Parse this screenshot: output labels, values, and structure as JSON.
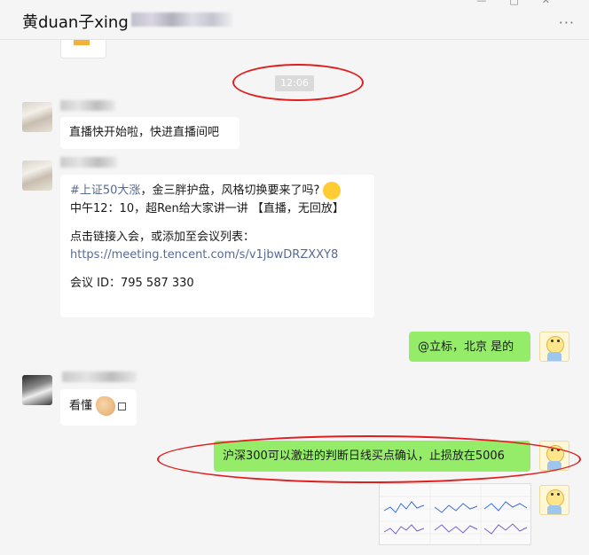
{
  "window": {
    "title": "黄duan子xing"
  },
  "messages": {
    "timestamp": "12:06",
    "m1": {
      "text": "直播快开始啦，快进直播间吧"
    },
    "m2": {
      "hashtag": "#上证50大涨",
      "line1_rest": "，金三胖护盘，风格切换要来了吗?",
      "line2": "中午12：10，超Ren给大家讲一讲 【直播，无回放】",
      "line3": "点击链接入会，或添加至会议列表：",
      "link": "https://meeting.tencent.com/s/v1jbwDRZXXY8",
      "line5": "会议 ID：795 587 330"
    },
    "m3": {
      "text": "@立标，北京 是的"
    },
    "m4": {
      "text": "看懂"
    },
    "m5": {
      "text": "沪深300可以激进的判断日线买点确认，止损放在5006"
    }
  },
  "icons": {
    "minimize": "minimize-icon",
    "maximize": "maximize-icon",
    "close": "close-icon",
    "more": "more-icon"
  },
  "colors": {
    "green_bubble": "#95ec69",
    "link": "#576b95",
    "annotation": "#e01e1e"
  }
}
